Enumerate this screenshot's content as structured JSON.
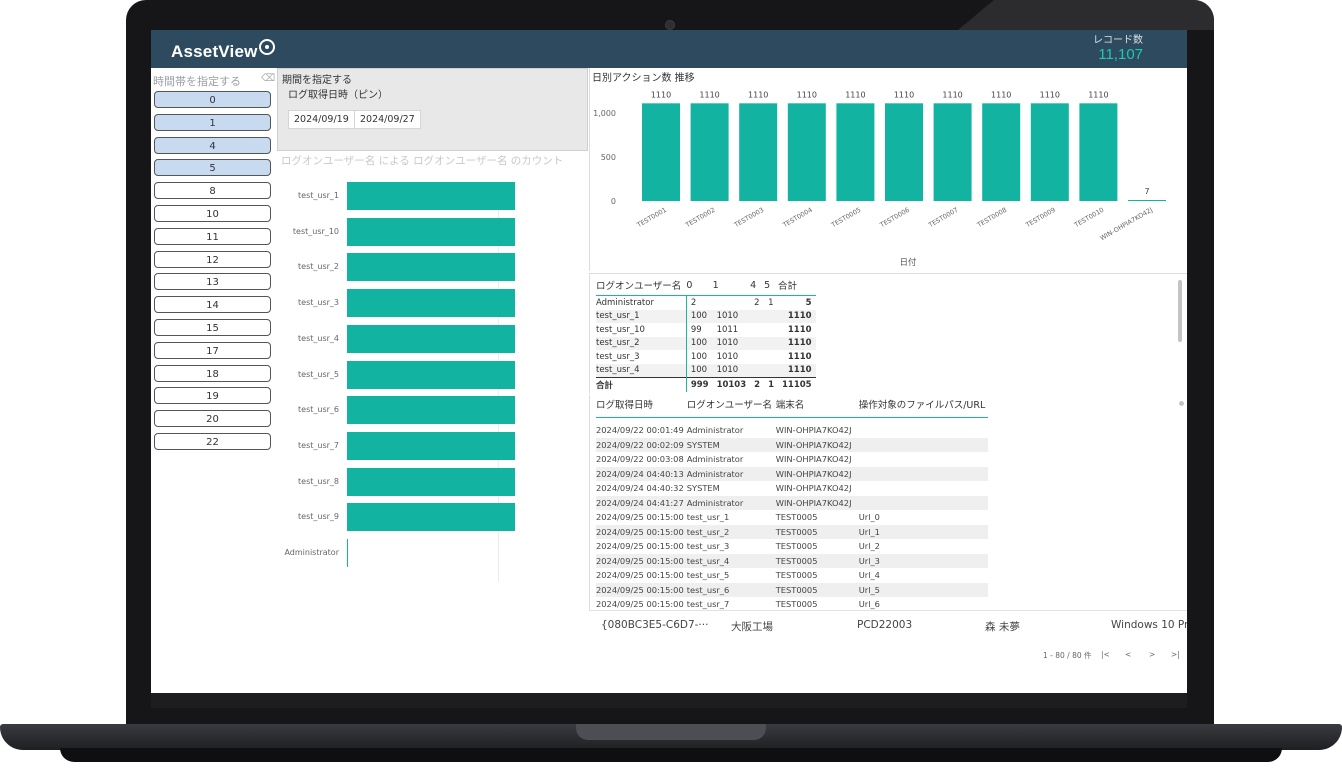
{
  "header": {
    "logo_text": "AssetView",
    "record_label": "レコード数",
    "record_value": "11,107"
  },
  "slicer": {
    "title": "時間帯を指定する",
    "items": [
      {
        "label": "0",
        "selected": true
      },
      {
        "label": "1",
        "selected": true
      },
      {
        "label": "4",
        "selected": true
      },
      {
        "label": "5",
        "selected": true
      },
      {
        "label": "8",
        "selected": false
      },
      {
        "label": "10",
        "selected": false
      },
      {
        "label": "11",
        "selected": false
      },
      {
        "label": "12",
        "selected": false
      },
      {
        "label": "13",
        "selected": false
      },
      {
        "label": "14",
        "selected": false
      },
      {
        "label": "15",
        "selected": false
      },
      {
        "label": "17",
        "selected": false
      },
      {
        "label": "18",
        "selected": false
      },
      {
        "label": "19",
        "selected": false
      },
      {
        "label": "20",
        "selected": false
      },
      {
        "label": "22",
        "selected": false
      }
    ]
  },
  "period": {
    "title": "期間を指定する",
    "subtitle": "ログ取得日時（ピン）",
    "start": "2024/09/19",
    "end": "2024/09/27"
  },
  "user_chart": {
    "title": "ログオンユーザー名 による ログオンユーザー名 のカウント",
    "color": "#13b3a2"
  },
  "daily_chart": {
    "title": "日別アクション数 推移",
    "xlabel": "日付",
    "color": "#13b3a2"
  },
  "chart_data": [
    {
      "type": "bar",
      "orientation": "horizontal",
      "title": "ログオンユーザー名 による ログオンユーザー名 のカウント",
      "categories": [
        "test_usr_1",
        "test_usr_10",
        "test_usr_2",
        "test_usr_3",
        "test_usr_4",
        "test_usr_5",
        "test_usr_6",
        "test_usr_7",
        "test_usr_8",
        "test_usr_9",
        "Administrator"
      ],
      "values": [
        1110,
        1110,
        1110,
        1110,
        1110,
        1110,
        1110,
        1110,
        1110,
        1110,
        5
      ],
      "xlim": [
        0,
        1110
      ]
    },
    {
      "type": "bar",
      "title": "日別アクション数 推移",
      "xlabel": "日付",
      "ylabel": "",
      "categories": [
        "TEST0001",
        "TEST0002",
        "TEST0003",
        "TEST0004",
        "TEST0005",
        "TEST0006",
        "TEST0007",
        "TEST0008",
        "TEST0009",
        "TEST0010",
        "WIN-OHPIA7KO42J"
      ],
      "values": [
        1110,
        1110,
        1110,
        1110,
        1110,
        1110,
        1110,
        1110,
        1110,
        1110,
        7
      ],
      "data_labels": [
        "1110",
        "1110",
        "1110",
        "1110",
        "1110",
        "1110",
        "1110",
        "1110",
        "1110",
        "1110",
        "7"
      ],
      "yticks": [
        "0",
        "500",
        "1,000"
      ],
      "ylim": [
        0,
        1250
      ]
    }
  ],
  "matrix": {
    "headers": [
      "ログオンユーザー名",
      "0",
      "1",
      "4",
      "5",
      "合計"
    ],
    "rows": [
      [
        "Administrator",
        "2",
        "",
        "2",
        "1",
        "5"
      ],
      [
        "test_usr_1",
        "100",
        "1010",
        "",
        "",
        "1110"
      ],
      [
        "test_usr_10",
        "99",
        "1011",
        "",
        "",
        "1110"
      ],
      [
        "test_usr_2",
        "100",
        "1010",
        "",
        "",
        "1110"
      ],
      [
        "test_usr_3",
        "100",
        "1010",
        "",
        "",
        "1110"
      ],
      [
        "test_usr_4",
        "100",
        "1010",
        "",
        "",
        "1110"
      ],
      [
        "合計",
        "999",
        "10103",
        "2",
        "1",
        "11105"
      ]
    ]
  },
  "log_table": {
    "headers": [
      "ログ取得日時",
      "ログオンユーザー名",
      "端末名",
      "操作対象のファイルパス/URL"
    ],
    "rows": [
      [
        "2024/09/22 00:01:49",
        "Administrator",
        "WIN-OHPIA7KO42J",
        ""
      ],
      [
        "2024/09/22 00:02:09",
        "SYSTEM",
        "WIN-OHPIA7KO42J",
        ""
      ],
      [
        "2024/09/22 00:03:08",
        "Administrator",
        "WIN-OHPIA7KO42J",
        ""
      ],
      [
        "2024/09/24 04:40:13",
        "Administrator",
        "WIN-OHPIA7KO42J",
        ""
      ],
      [
        "2024/09/24 04:40:32",
        "SYSTEM",
        "WIN-OHPIA7KO42J",
        ""
      ],
      [
        "2024/09/24 04:41:27",
        "Administrator",
        "WIN-OHPIA7KO42J",
        ""
      ],
      [
        "2024/09/25 00:15:00",
        "test_usr_1",
        "TEST0005",
        "Url_0"
      ],
      [
        "2024/09/25 00:15:00",
        "test_usr_2",
        "TEST0005",
        "Url_1"
      ],
      [
        "2024/09/25 00:15:00",
        "test_usr_3",
        "TEST0005",
        "Url_2"
      ],
      [
        "2024/09/25 00:15:00",
        "test_usr_4",
        "TEST0005",
        "Url_3"
      ],
      [
        "2024/09/25 00:15:00",
        "test_usr_5",
        "TEST0005",
        "Url_4"
      ],
      [
        "2024/09/25 00:15:00",
        "test_usr_6",
        "TEST0005",
        "Url_5"
      ],
      [
        "2024/09/25 00:15:00",
        "test_usr_7",
        "TEST0005",
        "Url_6"
      ]
    ]
  },
  "asset_row": {
    "guid": "{080BC3E5-C6D7-···",
    "location": "大阪工場",
    "pc": "PCD22003",
    "user": "森 未夢",
    "os": "Windows 10 Pr"
  },
  "pager": {
    "range": "1 - 80 / 80 件",
    "first": "|<",
    "prev": "<",
    "next": ">",
    "last": ">|"
  }
}
